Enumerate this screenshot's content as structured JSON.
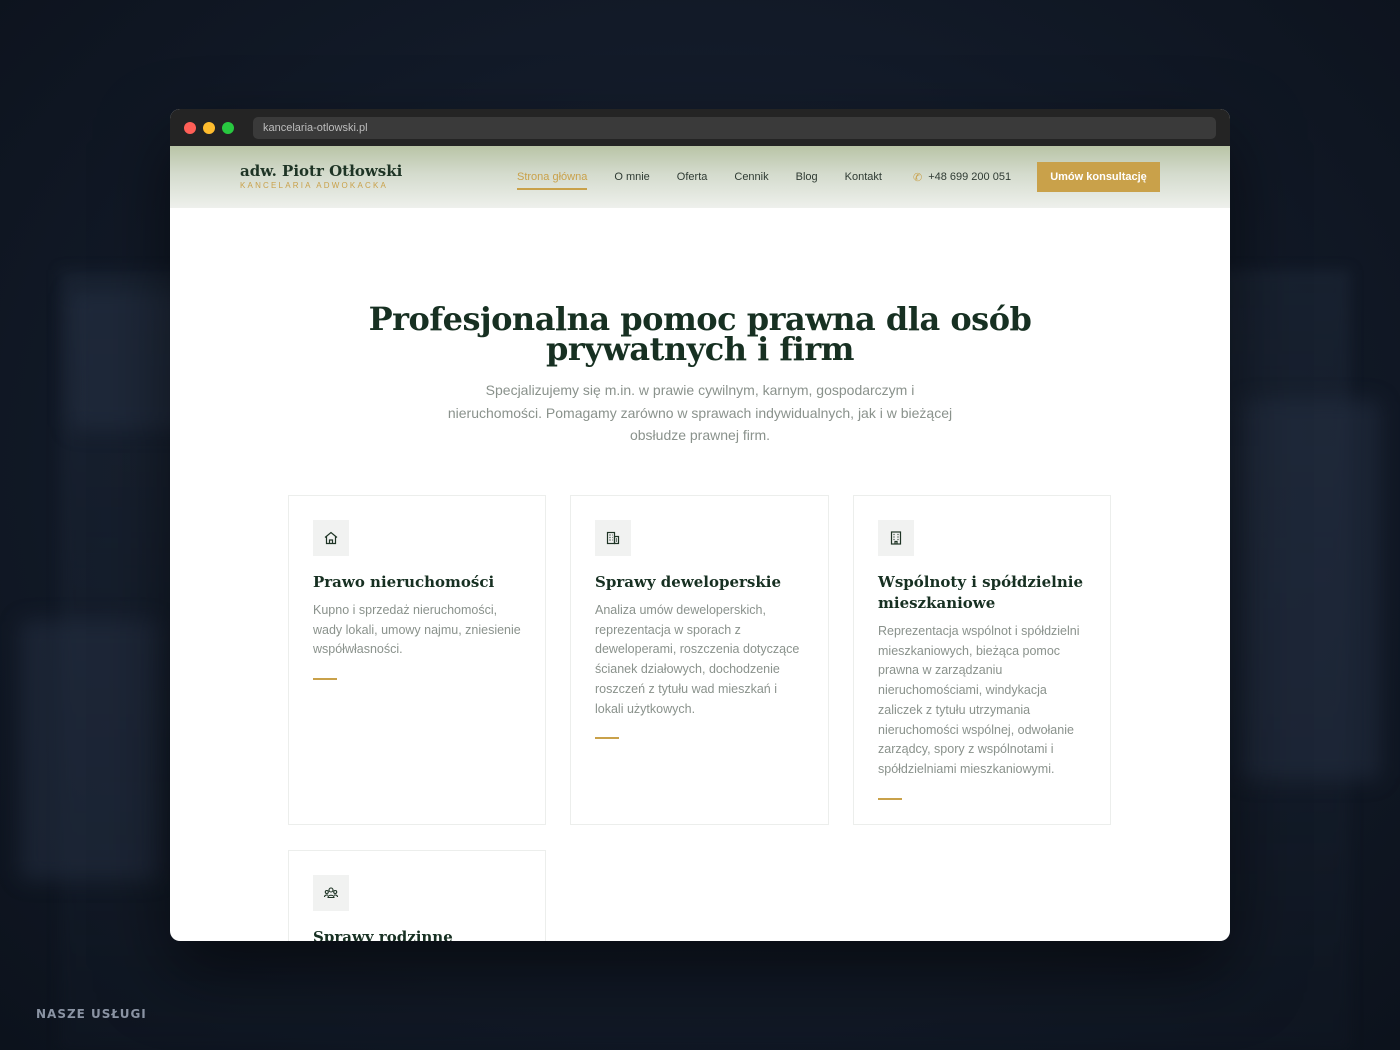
{
  "browser": {
    "url": "kancelaria-otlowski.pl"
  },
  "header": {
    "logo_name": "adw. Piotr Otłowski",
    "logo_subtitle": "KANCELARIA ADWOKACKA",
    "nav": [
      "Strona główna",
      "O mnie",
      "Oferta",
      "Cennik",
      "Blog",
      "Kontakt"
    ],
    "active_nav": "Strona główna",
    "phone": "+48 699 200 051",
    "cta_label": "Umów konsultację"
  },
  "hero": {
    "title": "Profesjonalna pomoc prawna dla osób prywatnych i firm",
    "subtitle": "Specjalizujemy się m.in. w prawie cywilnym, karnym, gospodarczym i nieruchomości. Pomagamy zarówno w sprawach indywidualnych, jak i w bieżącej obsłudze prawnej firm."
  },
  "cards": [
    {
      "icon": "home-icon",
      "title": "Prawo nieruchomości",
      "text": "Kupno i sprzedaż nieruchomości, wady lokali, umowy najmu, zniesienie współwłasności."
    },
    {
      "icon": "building-icon",
      "title": "Sprawy deweloperskie",
      "text": "Analiza umów deweloperskich, reprezentacja w sporach z deweloperami, roszczenia dotyczące ścianek działowych, dochodzenie roszczeń z tytułu wad mieszkań i lokali użytkowych."
    },
    {
      "icon": "apartment-icon",
      "title": "Wspólnoty i spółdzielnie mieszkaniowe",
      "text": "Reprezentacja wspólnot i spółdzielni mieszkaniowych, bieżąca pomoc prawna w zarządzaniu nieruchomościami, windykacja zaliczek z tytułu utrzymania nieruchomości wspólnej, odwołanie zarządcy, spory z wspólnotami i spółdzielniami mieszkaniowymi."
    },
    {
      "icon": "family-icon",
      "title": "Sprawy rodzinne",
      "text": ""
    }
  ],
  "footer_label": "NASZE USŁUGI",
  "colors": {
    "accent": "#c9a14a",
    "heading": "#173022",
    "body_text": "#8a928c",
    "chrome": "#242424"
  }
}
